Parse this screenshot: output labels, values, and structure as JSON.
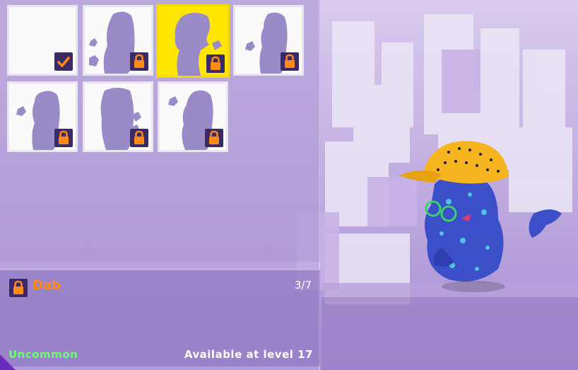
{
  "emote_grid": {
    "items": [
      {
        "id": "emote-1",
        "state": "equipped",
        "selected": false
      },
      {
        "id": "emote-2",
        "state": "locked",
        "selected": false
      },
      {
        "id": "emote-3",
        "state": "locked",
        "selected": true
      },
      {
        "id": "emote-4",
        "state": "locked",
        "selected": false
      },
      {
        "id": "emote-5",
        "state": "locked",
        "selected": false
      },
      {
        "id": "emote-6",
        "state": "locked",
        "selected": false
      },
      {
        "id": "emote-7",
        "state": "locked",
        "selected": false
      }
    ]
  },
  "details": {
    "name": "Dab",
    "counter": "3/7",
    "rarity": "Uncommon",
    "availability": "Available at level 17"
  },
  "icons": {
    "lock": "lock-icon",
    "check": "check-icon",
    "silhouette": "emote-silhouette-icon"
  },
  "colors": {
    "selected": "#ffe600",
    "lock_orange": "#ff8a14",
    "badge_bg": "#3b2a63",
    "rarity": "#6cff72",
    "silhouette": "#9a8ac8"
  }
}
